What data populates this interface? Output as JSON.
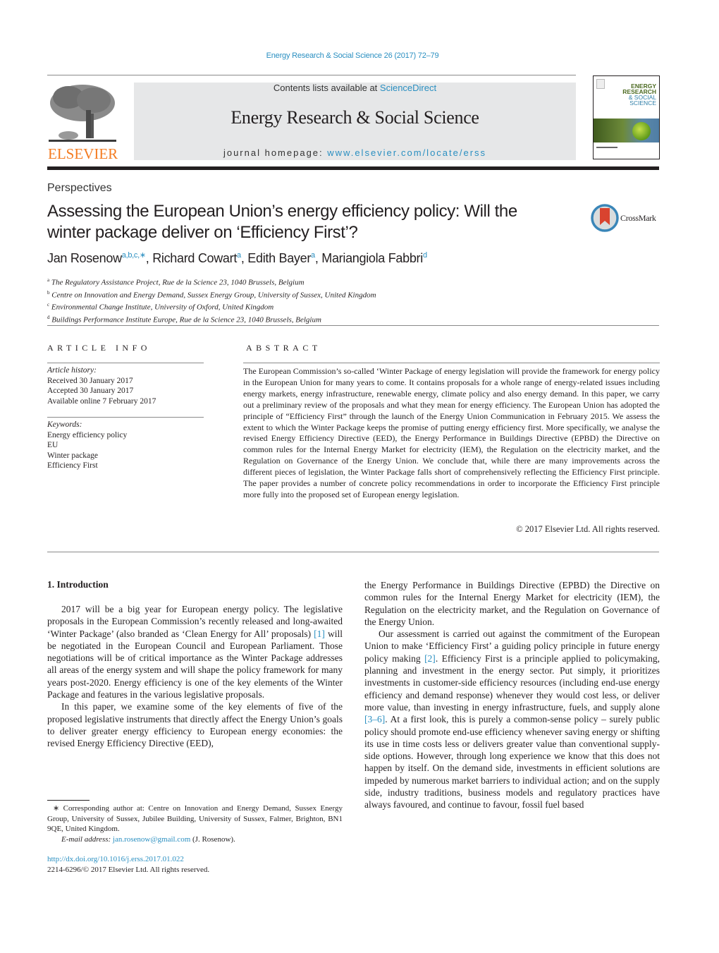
{
  "header": {
    "journal_ref": "Energy Research & Social Science 26 (2017) 72–79",
    "contents_prefix": "Contents lists available at ",
    "contents_link": "ScienceDirect",
    "journal_title": "Energy Research & Social Science",
    "homepage_prefix": "journal homepage: ",
    "homepage_link": "www.elsevier.com/locate/erss",
    "publisher_logo_text": "ELSEVIER",
    "cover": {
      "line1": "ENERGY",
      "line2": "RESEARCH",
      "line3": "& SOCIAL",
      "line4": "SCIENCE"
    }
  },
  "article": {
    "section": "Perspectives",
    "title_line1": "Assessing the European Union’s energy efficiency policy: Will the",
    "title_line2": "winter package deliver on ‘Efficiency First’?",
    "crossmark_label": "CrossMark",
    "authors": [
      {
        "name": "Jan Rosenow",
        "sup": "a,b,c,∗"
      },
      {
        "name": "Richard Cowart",
        "sup": "a"
      },
      {
        "name": "Edith Bayer",
        "sup": "a"
      },
      {
        "name": "Mariangiola Fabbri",
        "sup": "d"
      }
    ],
    "affiliations": [
      {
        "key": "a",
        "text": "The Regulatory Assistance Project, Rue de la Science 23, 1040 Brussels, Belgium"
      },
      {
        "key": "b",
        "text": "Centre on Innovation and Energy Demand, Sussex Energy Group, University of Sussex, United Kingdom"
      },
      {
        "key": "c",
        "text": "Environmental Change Institute, University of Oxford, United Kingdom"
      },
      {
        "key": "d",
        "text": "Buildings Performance Institute Europe, Rue de la Science 23, 1040 Brussels, Belgium"
      }
    ]
  },
  "article_info": {
    "heading": "ARTICLE INFO",
    "history_label": "Article history:",
    "received": "Received 30 January 2017",
    "accepted": "Accepted 30 January 2017",
    "online": "Available online 7 February 2017",
    "keywords_label": "Keywords:",
    "keywords": [
      "Energy efficiency policy",
      "EU",
      "Winter package",
      "Efficiency First"
    ]
  },
  "abstract": {
    "heading": "ABSTRACT",
    "text": "The European Commission’s so-called ‘Winter Package of energy legislation will provide the framework for energy policy in the European Union for many years to come. It contains proposals for a whole range of energy-related issues including energy markets, energy infrastructure, renewable energy, climate policy and also energy demand. In this paper, we carry out a preliminary review of the proposals and what they mean for energy efficiency. The European Union has adopted the principle of “Efficiency First” through the launch of the Energy Union Communication in February 2015. We assess the extent to which the Winter Package keeps the promise of putting energy efficiency first. More specifically, we analyse the revised Energy Efficiency Directive (EED), the Energy Performance in Buildings Directive (EPBD) the Directive on common rules for the Internal Energy Market for electricity (IEM), the Regulation on the electricity market, and the Regulation on Governance of the Energy Union. We conclude that, while there are many improvements across the different pieces of legislation, the Winter Package falls short of comprehensively reflecting the Efficiency First principle. The paper provides a number of concrete policy recommendations in order to incorporate the Efficiency First principle more fully into the proposed set of European energy legislation.",
    "copyright": "© 2017 Elsevier Ltd. All rights reserved."
  },
  "body": {
    "section_heading": "1.  Introduction",
    "left": {
      "p1_a": "2017 will be a big year for European energy policy. The legislative proposals in the European Commission’s recently released and long-awaited ‘Winter Package’ (also branded as ‘Clean Energy for All’ proposals) ",
      "p1_ref": "[1]",
      "p1_b": " will be negotiated in the European Council and European Parliament. Those negotiations will be of critical importance as the Winter Package addresses all areas of the energy system and will shape the policy framework for many years post-2020. Energy efficiency is one of the key elements of the Winter Package and features in the various legislative proposals.",
      "p2": "In this paper, we examine some of the key elements of five of the proposed legislative instruments that directly affect the Energy Union’s goals to deliver greater energy efficiency to European energy economies: the revised Energy Efficiency Directive (EED),"
    },
    "right": {
      "p1": "the Energy Performance in Buildings Directive (EPBD) the Directive on common rules for the Internal Energy Market for electricity (IEM), the Regulation on the electricity market, and the Regulation on Governance of the Energy Union.",
      "p2_a": "Our assessment is carried out against the commitment of the European Union to make ‘Efficiency First’ a guiding policy principle in future energy policy making ",
      "p2_ref1": "[2]",
      "p2_b": ". Efficiency First is a principle applied to policymaking, planning and investment in the energy sector. Put simply, it prioritizes investments in customer-side efficiency resources (including end-use energy efficiency and demand response) whenever they would cost less, or deliver more value, than investing in energy infrastructure, fuels, and supply alone ",
      "p2_ref2": "[3–6]",
      "p2_c": ". At a first look, this is purely a common-sense policy – surely public policy should promote end-use efficiency whenever saving energy or shifting its use in time costs less or delivers greater value than conventional supply-side options. However, through long experience we know that this does not happen by itself. On the demand side, investments in efficient solutions are impeded by numerous market barriers to individual action; and on the supply side, industry traditions, business models and regulatory practices have always favoured, and continue to favour, fossil fuel based"
    }
  },
  "footnotes": {
    "corresponding": "∗ Corresponding author at: Centre on Innovation and Energy Demand, Sussex Energy Group, University of Sussex, Jubilee Building, University of Sussex, Falmer, Brighton, BN1 9QE, United Kingdom.",
    "email_label": "E-mail address: ",
    "email": "jan.rosenow@gmail.com",
    "email_suffix": " (J. Rosenow).",
    "doi": "http://dx.doi.org/10.1016/j.erss.2017.01.022",
    "issn_copyright": "2214-6296/© 2017 Elsevier Ltd. All rights reserved."
  },
  "colors": {
    "link": "#2a8fc1",
    "elsevier_orange": "#f47b20",
    "banner_grey": "#e6e7e8"
  }
}
